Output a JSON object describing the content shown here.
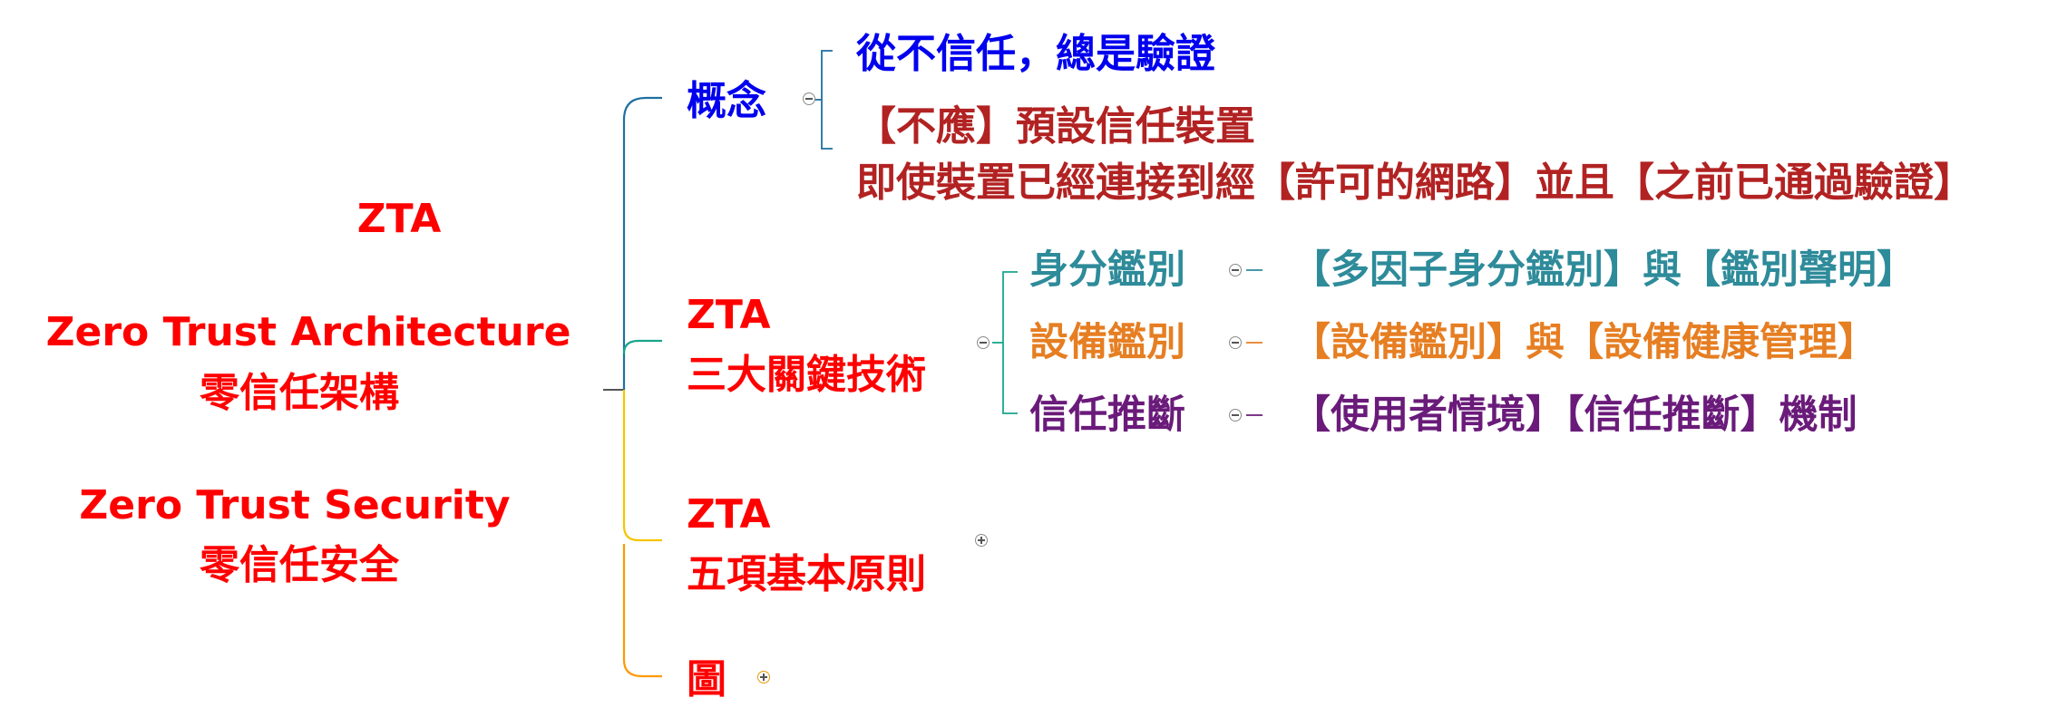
{
  "root": {
    "abbr": "ZTA",
    "line1": "Zero Trust Architecture",
    "line2": "零信任架構",
    "line3": "Zero Trust Security",
    "line4": "零信任安全"
  },
  "colors": {
    "red": "#ff0000",
    "blue": "#0000ee",
    "brown": "#b22222",
    "teal": "#2e8b9a",
    "orange": "#e67e22",
    "purple": "#6a1b7a",
    "link_blue": "#1f6fa0",
    "link_teal": "#1aa58c",
    "link_yellow": "#f5c400",
    "link_orange": "#ff9900"
  },
  "branches": {
    "concept": {
      "label": "概念",
      "children": [
        "從不信任，總是驗證",
        "【不應】預設信任裝置",
        "即使裝置已經連接到經【許可的網路】並且【之前已通過驗證】"
      ]
    },
    "tech": {
      "label_line1": "ZTA",
      "label_line2": "三大關鍵技術",
      "items": [
        {
          "label": "身分鑑別",
          "detail": "【多因子身分鑑別】與【鑑別聲明】"
        },
        {
          "label": "設備鑑別",
          "detail": "【設備鑑別】與【設備健康管理】"
        },
        {
          "label": "信任推斷",
          "detail": "【使用者情境】【信任推斷】機制"
        }
      ]
    },
    "principles": {
      "label_line1": "ZTA",
      "label_line2": "五項基本原則"
    },
    "figure": {
      "label": "圖"
    }
  }
}
